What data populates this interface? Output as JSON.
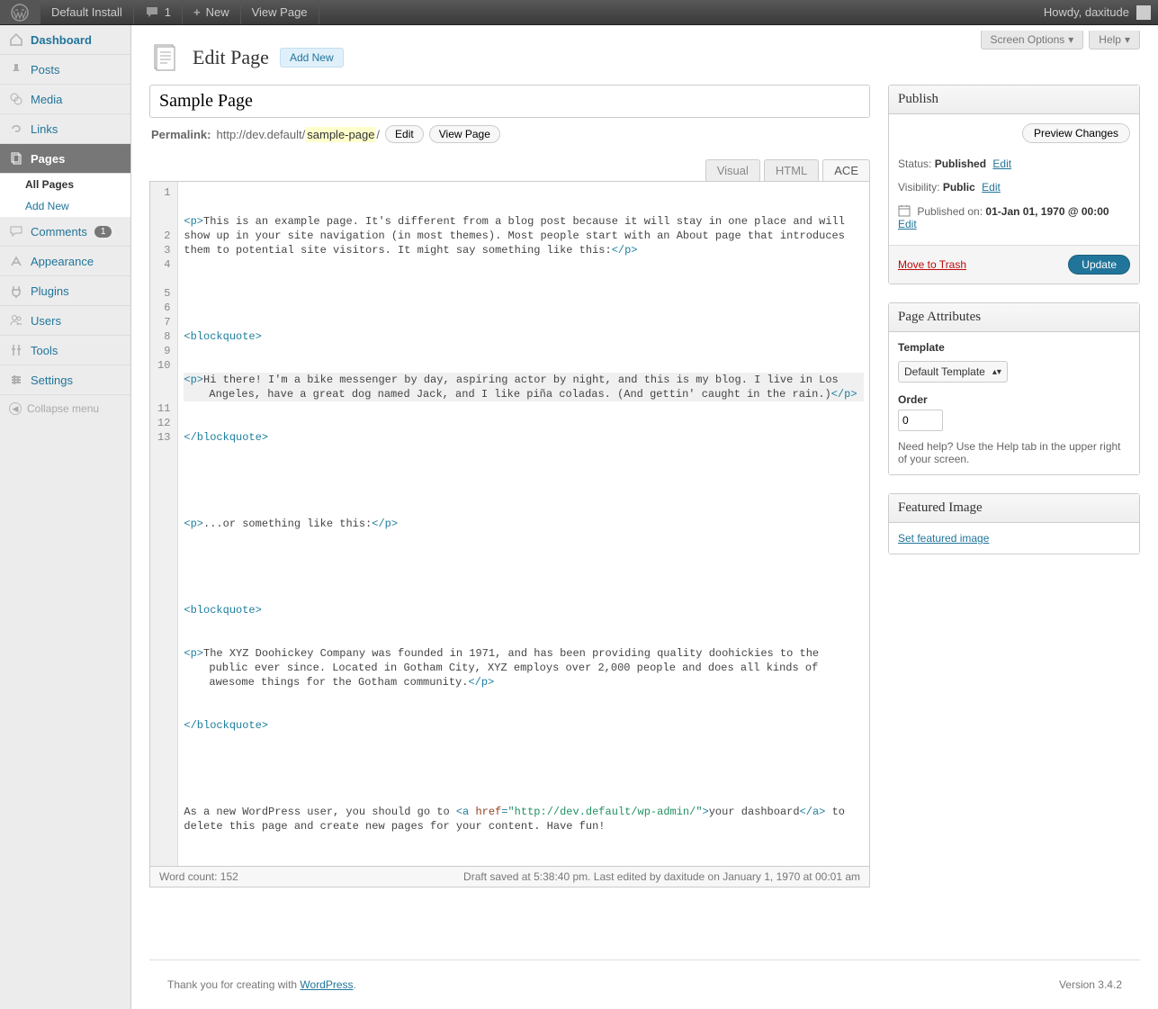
{
  "adminBar": {
    "siteName": "Default Install",
    "commentsCount": "1",
    "newLabel": "New",
    "viewPageLabel": "View Page",
    "greeting": "Howdy, daxitude"
  },
  "sidebar": {
    "items": [
      {
        "label": "Dashboard",
        "bold": true
      },
      {
        "label": "Posts"
      },
      {
        "label": "Media"
      },
      {
        "label": "Links"
      },
      {
        "label": "Pages",
        "current": true,
        "sub": [
          {
            "label": "All Pages",
            "current": true
          },
          {
            "label": "Add New"
          }
        ]
      },
      {
        "label": "Comments",
        "badge": "1"
      },
      {
        "label": "Appearance"
      },
      {
        "label": "Plugins"
      },
      {
        "label": "Users"
      },
      {
        "label": "Tools"
      },
      {
        "label": "Settings"
      }
    ],
    "collapse": "Collapse menu"
  },
  "screenMeta": {
    "screenOptions": "Screen Options",
    "help": "Help"
  },
  "pageHeader": {
    "title": "Edit Page",
    "addNew": "Add New"
  },
  "titleField": "Sample Page",
  "permalink": {
    "label": "Permalink:",
    "urlPrefix": "http://dev.default/",
    "slug": "sample-page",
    "urlSuffix": "/",
    "edit": "Edit",
    "viewPage": "View Page"
  },
  "editorTabs": {
    "visual": "Visual",
    "html": "HTML",
    "ace": "ACE"
  },
  "code": {
    "l1": "This is an example page. It's different from a blog post because it will stay in one place and will show up in your site navigation (in most themes). Most people start with an About page that introduces them to potential site visitors. It might say something like this:",
    "l4": "Hi there! I'm a bike messenger by day, aspiring actor by night, and this is my blog. I live in Los Angeles, have a great dog named Jack, and I like piña coladas. (And gettin' caught in the rain.)",
    "l7": "...or something like this:",
    "l10": "The XYZ Doohickey Company was founded in 1971, and has been providing quality doohickies to the public ever since. Located in Gotham City, XYZ employs over 2,000 people and does all kinds of awesome things for the Gotham community.",
    "l13a": "As a new WordPress user, you should go to ",
    "l13url": "\"http://dev.default/wp-admin/\"",
    "l13link": "your dashboard",
    "l13b": " to delete this page and create new pages for your content. Have fun!"
  },
  "editorFooter": {
    "wordCount": "Word count: 152",
    "status": "Draft saved at 5:38:40 pm. Last edited by daxitude on January 1, 1970 at 00:01 am"
  },
  "publish": {
    "title": "Publish",
    "preview": "Preview Changes",
    "statusLabel": "Status:",
    "statusValue": "Published",
    "visibilityLabel": "Visibility:",
    "visibilityValue": "Public",
    "publishedLabel": "Published on:",
    "publishedValue": "01-Jan 01, 1970 @ 00:00",
    "editLink": "Edit",
    "trash": "Move to Trash",
    "update": "Update"
  },
  "pageAttributes": {
    "title": "Page Attributes",
    "templateLabel": "Template",
    "templateValue": "Default Template",
    "orderLabel": "Order",
    "orderValue": "0",
    "help": "Need help? Use the Help tab in the upper right of your screen."
  },
  "featuredImage": {
    "title": "Featured Image",
    "link": "Set featured image"
  },
  "footer": {
    "thanks": "Thank you for creating with ",
    "wordpress": "WordPress",
    "version": "Version 3.4.2"
  }
}
